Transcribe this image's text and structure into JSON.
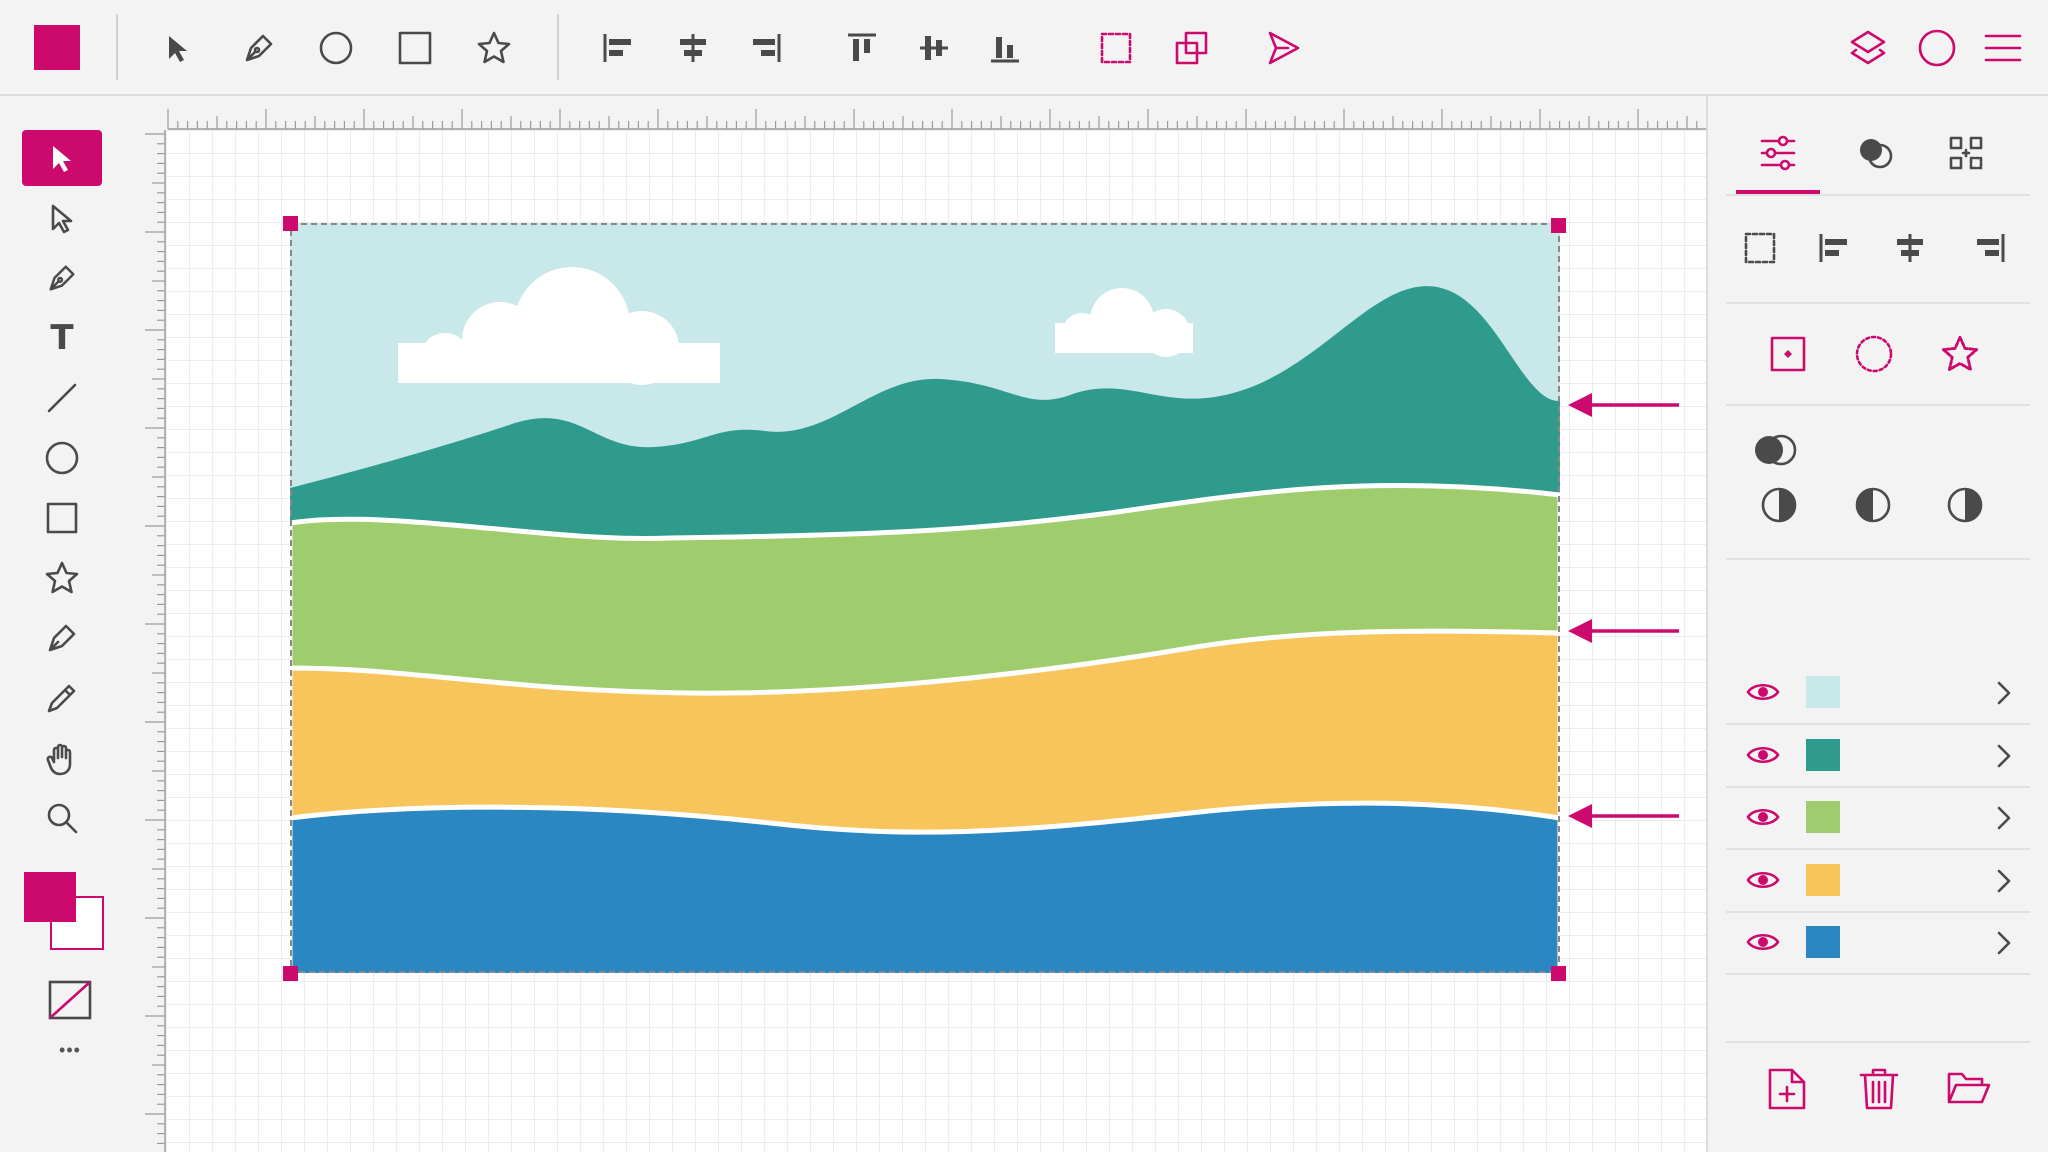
{
  "theme": {
    "accent": "#cc0a6e",
    "canvas": "#ffffff",
    "chrome": "#f3f3f3"
  },
  "toolbar": {
    "items": [
      "brand-swatch",
      "select-icon",
      "pen-icon",
      "ellipse-icon",
      "rectangle-icon",
      "star-icon",
      "align-left-icon",
      "align-center-icon",
      "align-right-icon",
      "align-top-icon",
      "align-middle-icon",
      "align-bottom-icon",
      "group-selection-icon",
      "duplicate-icon",
      "send-icon",
      "layers-icon",
      "circle-icon",
      "menu-icon"
    ]
  },
  "tools": {
    "items": [
      "select-icon",
      "direct-select-icon",
      "pen-icon",
      "text-icon",
      "line-icon",
      "ellipse-icon",
      "rectangle-icon",
      "star-icon",
      "brush-icon",
      "pencil-icon",
      "hand-icon",
      "zoom-icon"
    ],
    "text_tool_glyph": "T",
    "more_glyph": "•••",
    "fill_color": "#cc0a6e",
    "stroke_color": "#ffffff"
  },
  "artwork": {
    "colors": {
      "sky": "#c8e8ea",
      "mountain": "#2e9b8d",
      "meadow": "#9fcd6e",
      "sand": "#f7c55b",
      "water": "#2b87c1",
      "cloud": "#ffffff"
    }
  },
  "panel": {
    "tabs": [
      "properties-icon",
      "blend-icon",
      "grid-icon"
    ],
    "active_tab": 0,
    "layers": [
      {
        "name": "sky-layer",
        "color": "#c8e8ea"
      },
      {
        "name": "mountain-layer",
        "color": "#2e9b8d"
      },
      {
        "name": "meadow-layer",
        "color": "#9fcd6e"
      },
      {
        "name": "sand-layer",
        "color": "#f7c55b"
      },
      {
        "name": "water-layer",
        "color": "#2b87c1"
      }
    ],
    "footer": [
      "new-page-icon",
      "trash-icon",
      "folder-icon"
    ]
  }
}
